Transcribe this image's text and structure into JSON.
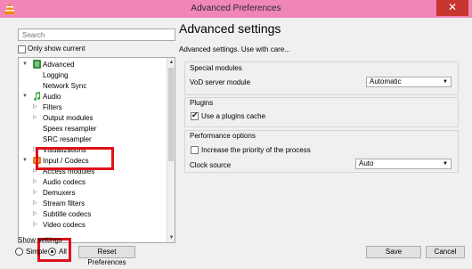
{
  "window": {
    "title": "Advanced Preferences",
    "close_symbol": "✕",
    "titlebar_color": "#f086b8"
  },
  "left": {
    "search_placeholder": "Search",
    "only_show_current": "Only show current",
    "tree": [
      {
        "label": "Advanced",
        "arrow": "▼",
        "icon": "advanced-icon"
      },
      {
        "label": "Logging",
        "arrow": ""
      },
      {
        "label": "Network Sync",
        "arrow": ""
      },
      {
        "label": "Audio",
        "arrow": "▼",
        "icon": "music-note-icon"
      },
      {
        "label": "Filters",
        "arrow": "▷"
      },
      {
        "label": "Output modules",
        "arrow": "▷"
      },
      {
        "label": "Speex resampler",
        "arrow": ""
      },
      {
        "label": "SRC resampler",
        "arrow": ""
      },
      {
        "label": "Visualizations",
        "arrow": "▷"
      },
      {
        "label": "Input / Codecs",
        "arrow": "▼",
        "icon": "codec-icon"
      },
      {
        "label": "Access modules",
        "arrow": "▷"
      },
      {
        "label": "Audio codecs",
        "arrow": "▷"
      },
      {
        "label": "Demuxers",
        "arrow": "▷"
      },
      {
        "label": "Stream filters",
        "arrow": "▷"
      },
      {
        "label": "Subtitle codecs",
        "arrow": "▷"
      },
      {
        "label": "Video codecs",
        "arrow": "▷"
      }
    ],
    "show_settings_label": "Show settings",
    "simple_label": "Simple",
    "all_label": "All",
    "selected_mode": "All",
    "reset_label": "Reset Preferences"
  },
  "right": {
    "heading": "Advanced settings",
    "subheading": "Advanced settings. Use with care...",
    "special_modules": {
      "title": "Special modules",
      "vod_label": "VoD server module",
      "vod_value": "Automatic"
    },
    "plugins": {
      "title": "Plugins",
      "use_cache_label": "Use a plugins cache",
      "use_cache_checked": true
    },
    "performance": {
      "title": "Performance options",
      "increase_priority_label": "Increase the priority of the process",
      "increase_priority_checked": false,
      "clock_label": "Clock source",
      "clock_value": "Auto"
    }
  },
  "buttons": {
    "save": "Save",
    "cancel": "Cancel"
  },
  "highlight_color": "#e0101a"
}
